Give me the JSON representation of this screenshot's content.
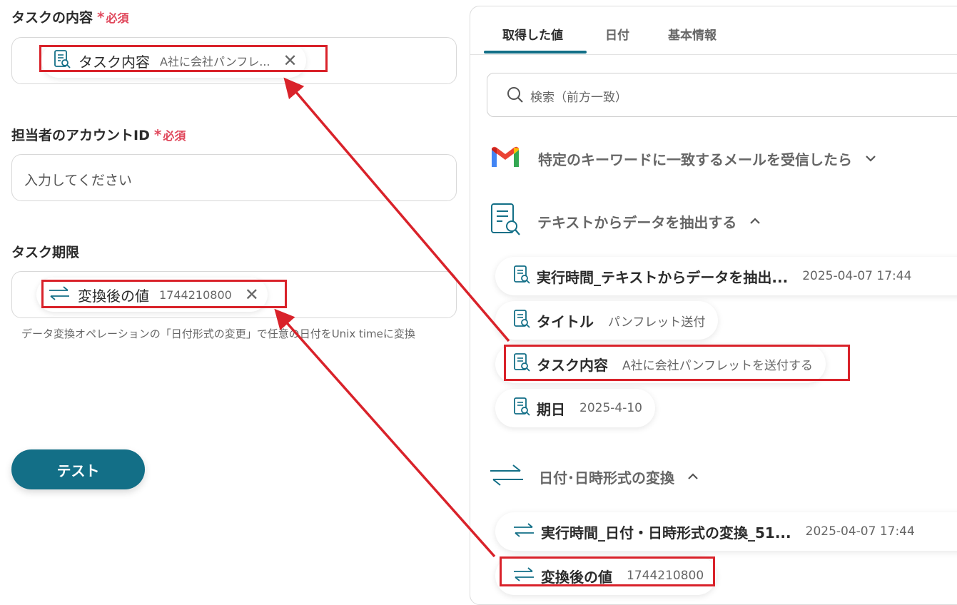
{
  "form": {
    "fields": [
      {
        "label": "タスクの内容",
        "required_star": "*",
        "required_text": "必須",
        "chip": {
          "name": "タスク内容",
          "value": "A社に会社パンフレ...",
          "icon": "text-extract-icon"
        }
      },
      {
        "label": "担当者のアカウントID",
        "required_star": "*",
        "required_text": "必須",
        "placeholder": "入力してください"
      },
      {
        "label": "タスク期限",
        "chip": {
          "name": "変換後の値",
          "value": "1744210800",
          "icon": "convert-arrows-icon"
        },
        "hint": "データ変換オペレーションの「日付形式の変更」で任意の日付をUnix timeに変換"
      }
    ],
    "test_button": "テスト"
  },
  "panel": {
    "tabs": [
      "取得した値",
      "日付",
      "基本情報"
    ],
    "active_tab": 0,
    "search_placeholder": "検索（前方一致）",
    "sections": [
      {
        "title": "特定のキーワードに一致するメールを受信したら",
        "icon": "gmail-icon",
        "expanded": false,
        "items": []
      },
      {
        "title": "テキストからデータを抽出する",
        "icon": "text-extract-icon",
        "expanded": true,
        "items": [
          {
            "name": "実行時間_テキストからデータを抽出...",
            "value": "2025-04-07 17:44"
          },
          {
            "name": "タイトル",
            "value": "パンフレット送付"
          },
          {
            "name": "タスク内容",
            "value": "A社に会社パンフレットを送付する",
            "highlighted": true
          },
          {
            "name": "期日",
            "value": "2025-4-10"
          }
        ]
      },
      {
        "title": "日付･日時形式の変換",
        "icon": "convert-arrows-icon",
        "expanded": true,
        "items": [
          {
            "name": "実行時間_日付・日時形式の変換_51...",
            "value": "2025-04-07 17:44"
          },
          {
            "name": "変換後の値",
            "value": "1744210800",
            "highlighted": true
          }
        ]
      }
    ]
  },
  "colors": {
    "accent": "#136f87",
    "required": "#e0475b",
    "annotation": "#d9222a"
  }
}
